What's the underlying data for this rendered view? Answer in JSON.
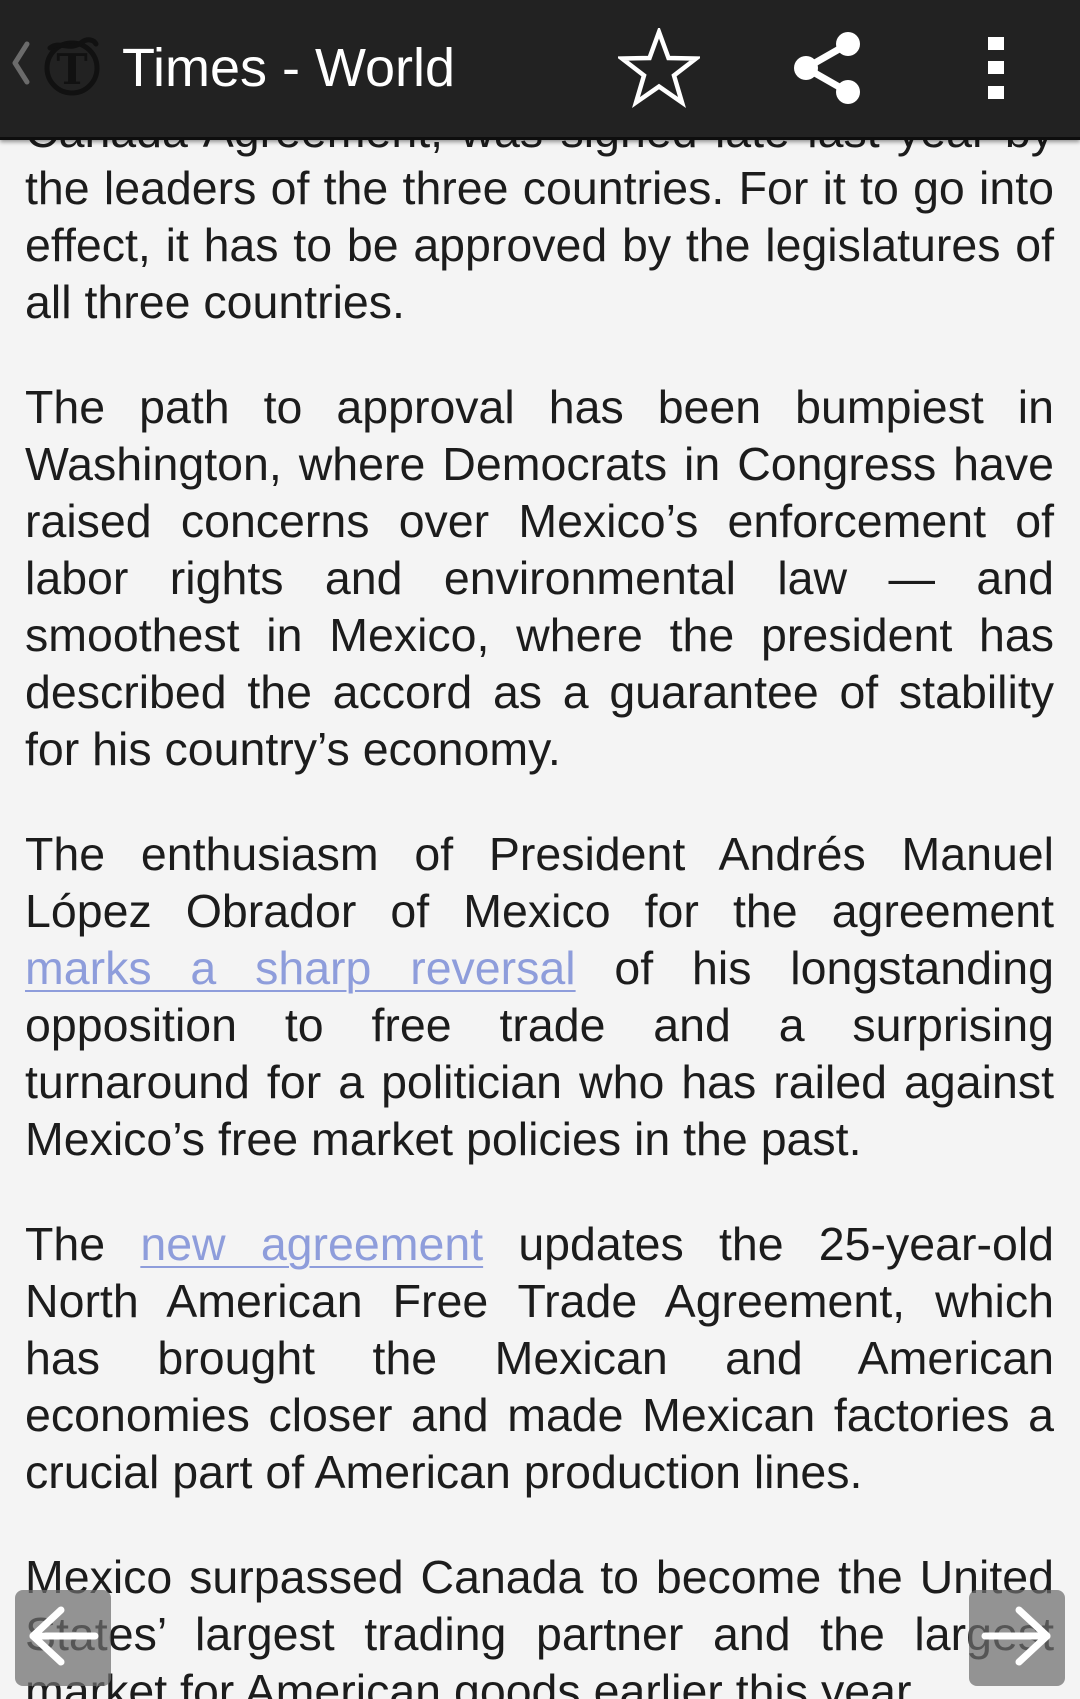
{
  "appbar": {
    "title": "Times - World",
    "back_icon": "chevron-left-icon",
    "logo_icon": "nyt-logo-icon",
    "bookmark_icon": "star-outline-icon",
    "share_icon": "share-icon",
    "overflow_icon": "more-vert-icon"
  },
  "article": {
    "p0": {
      "clipped_line": "Canada Agreement, was signed late last year by",
      "text": "the leaders of the three countries. For it to go into effect, it has to be approved by the legislatures of all three countries."
    },
    "p1": {
      "text": "The path to approval has been bumpiest in Washington, where Democrats in Congress have raised concerns over Mexico’s enforcement of labor rights and environmental law — and smoothest in Mexico, where the president has described the accord as a guarantee of stability for his country’s economy."
    },
    "p2": {
      "before": "The enthusiasm of President Andrés Manuel López Obrador of Mexico for the agreement ",
      "link": "marks a sharp reversal",
      "after": " of his longstanding opposition to free trade and a surprising turnaround for a politician who has railed against Mexico’s free market policies in the past."
    },
    "p3": {
      "before": "The ",
      "link": "new agreement",
      "after": " updates the 25-year-old North American Free Trade Agreement, which has brought the Mexican and American economies closer and made Mexican factories a crucial part of American production lines."
    },
    "p4": {
      "text": "Mexico surpassed Canada to become the United States’ largest trading partner and the largest market for American goods earlier this year."
    }
  },
  "nav": {
    "prev_icon": "arrow-left-icon",
    "next_icon": "arrow-right-icon"
  },
  "colors": {
    "appbar_bg": "#222222",
    "page_bg": "#f4f4f4",
    "text": "#1c1c1c",
    "link": "#8e9ddb"
  }
}
